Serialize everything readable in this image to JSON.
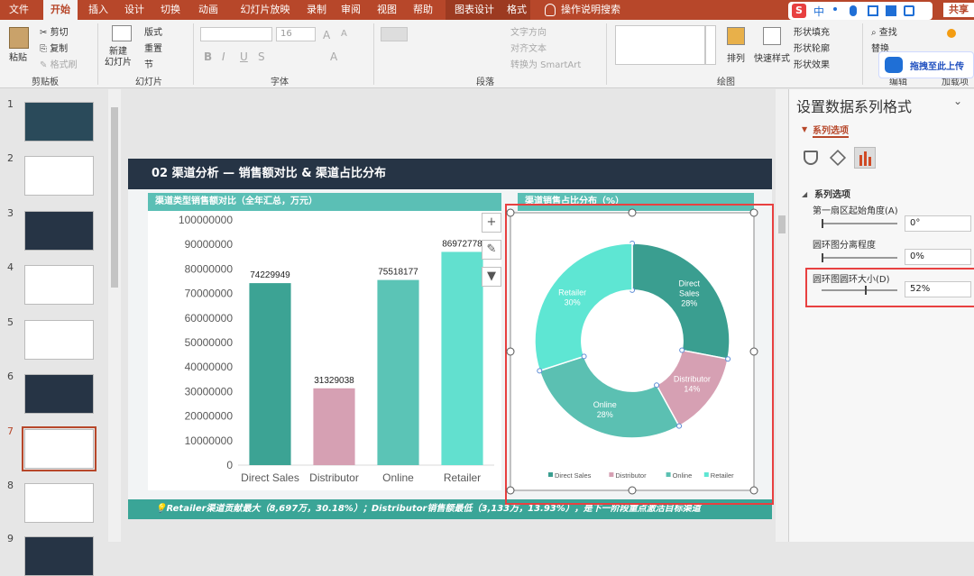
{
  "ribbon_tabs": [
    "文件",
    "开始",
    "插入",
    "设计",
    "切换",
    "动画",
    "幻灯片放映",
    "录制",
    "审阅",
    "视图",
    "帮助",
    "图表设计",
    "格式",
    "操作说明搜索"
  ],
  "share_label": "共享",
  "ime_label": "中",
  "clipboard": {
    "paste": "粘贴",
    "cut": "剪切",
    "copy": "复制",
    "format_painter": "格式刷",
    "group": "剪贴板"
  },
  "slides_group": {
    "new_slide": "新建\n幻灯片",
    "layout": "版式",
    "reset": "重置",
    "section": "节",
    "group": "幻灯片"
  },
  "font_group": {
    "font_size": "16",
    "group": "字体"
  },
  "paragraph_group": {
    "text_direction": "文字方向",
    "align_text": "对齐文本",
    "convert_smartart": "转换为 SmartArt",
    "group": "段落"
  },
  "drawing_group": {
    "arrange": "排列",
    "quick_styles": "快速样式",
    "shape_fill": "形状填充",
    "shape_outline": "形状轮廓",
    "shape_effects": "形状效果",
    "group": "绘图"
  },
  "editing_group": {
    "find": "查找",
    "replace": "替换",
    "group": "编辑"
  },
  "addins_group": {
    "group": "加载项"
  },
  "cloud_button": "拖拽至此上传",
  "thumbnails": [
    "1",
    "2",
    "3",
    "4",
    "5",
    "6",
    "7",
    "8",
    "9"
  ],
  "selected_slide": "7",
  "slide": {
    "title": "02  渠道分析 — 销售额对比 & 渠道占比分布",
    "bar_title": "渠道类型销售额对比（全年汇总，万元）",
    "donut_title": "渠道销售占比分布（%）",
    "footer": "💡Retailer渠道贡献最大（8,697万，30.18%）；Distributor销售额最低（3,133万，13.93%），是下一阶段重点激活目标渠道"
  },
  "chart_data": [
    {
      "type": "bar",
      "categories": [
        "Direct Sales",
        "Distributor",
        "Online",
        "Retailer"
      ],
      "values": [
        74229949,
        31329038,
        75518177,
        86972778
      ],
      "ylim": [
        0,
        100000000
      ],
      "yticks": [
        "0",
        "10000000",
        "20000000",
        "30000000",
        "40000000",
        "50000000",
        "60000000",
        "70000000",
        "80000000",
        "90000000",
        "100000000"
      ],
      "colors": [
        "#3ca394",
        "#d6a0b3",
        "#5bc4b6",
        "#62e0cf"
      ],
      "grid": false
    },
    {
      "type": "pie",
      "categories": [
        "Direct Sales",
        "Distributor",
        "Online",
        "Retailer"
      ],
      "values": [
        28,
        14,
        28,
        30
      ],
      "labels": [
        "Direct\nSales\n28%",
        "Distributor\n14%",
        "Online\n28%",
        "Retailer\n30%"
      ],
      "colors": [
        "#3a9e90",
        "#d6a0b3",
        "#5bc0b2",
        "#5ee6d3"
      ],
      "hole": 0.52,
      "legend": "bottom"
    }
  ],
  "format_pane": {
    "title": "设置数据系列格式",
    "tab": "系列选项",
    "section": "系列选项",
    "first_slice_angle_label": "第一扇区起始角度(A)",
    "first_slice_angle": "0°",
    "explosion_label": "圆环图分离程度",
    "explosion": "0%",
    "hole_size_label": "圆环图圆环大小(D)",
    "hole_size": "52%"
  },
  "colors": {
    "accent": "#b7472a",
    "highlight": "#e84040",
    "header": "#263445",
    "teal": "#5bbfb5"
  }
}
